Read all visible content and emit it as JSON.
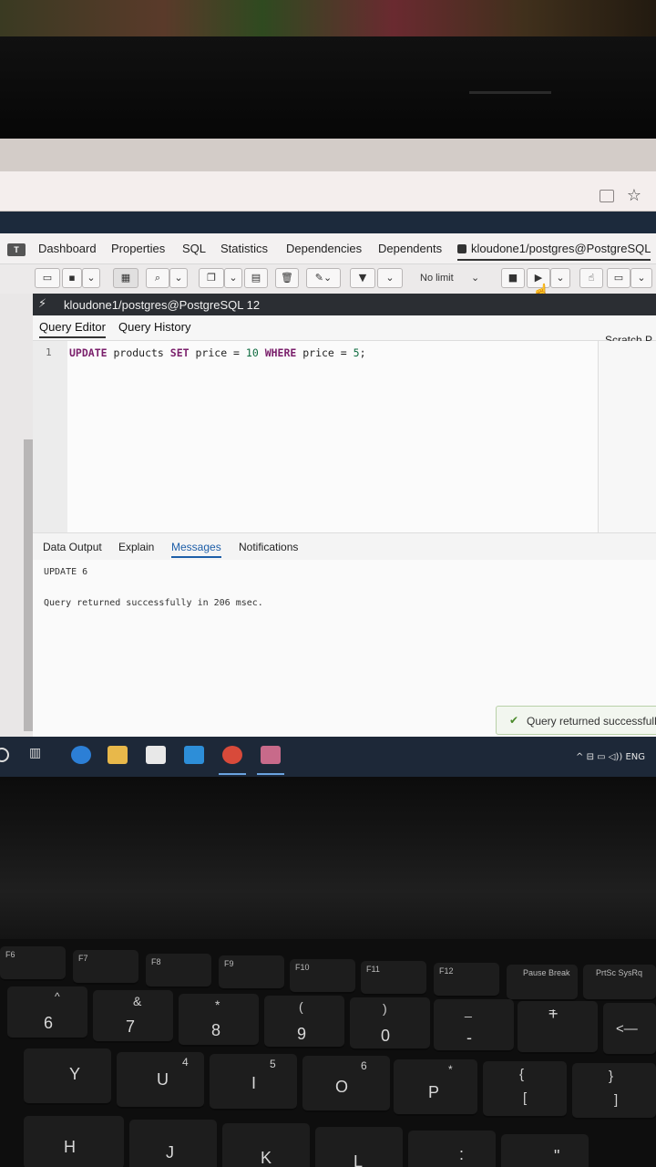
{
  "browser": {
    "reader_icon": "reader-icon",
    "star_icon": "star-icon"
  },
  "pgadmin": {
    "tabs": [
      {
        "label": "Dashboard"
      },
      {
        "label": "Properties"
      },
      {
        "label": "SQL"
      },
      {
        "label": "Statistics"
      },
      {
        "label": "Dependencies"
      },
      {
        "label": "Dependents"
      },
      {
        "label": "kloudone1/postgres@PostgreSQL"
      }
    ],
    "toolbar": {
      "limit_select": "No limit"
    },
    "connection": "kloudone1/postgres@PostgreSQL 12",
    "editor_tabs": [
      "Query Editor",
      "Query History"
    ],
    "scratch_label": "Scratch P",
    "editor": {
      "line_number": "1",
      "code": {
        "kw1": "UPDATE",
        "t1": " products ",
        "kw2": "SET",
        "t2": " price = ",
        "n1": "10",
        "t3": " ",
        "kw3": "WHERE",
        "t4": " price = ",
        "n2": "5",
        "t5": ";"
      }
    },
    "output_tabs": [
      "Data Output",
      "Explain",
      "Messages",
      "Notifications"
    ],
    "messages": {
      "line1": "UPDATE 6",
      "line2": "Query returned successfully in 206 msec."
    },
    "toast": "Query returned successfully"
  },
  "taskbar": {
    "tray_text": "^ ⊟ ▭ ◁)) ENG"
  },
  "keyboard": {
    "fn_row": [
      "F6",
      "F7",
      "F8",
      "F9",
      "F10",
      "F11",
      "F12",
      "Pause Break",
      "PrtSc SysRq"
    ],
    "num_row": [
      "6",
      "7",
      "8",
      "9",
      "0",
      "-",
      "+",
      "<—"
    ],
    "num_row_shift": [
      "^",
      "&",
      "*",
      "(",
      ")",
      "_",
      "=",
      ""
    ],
    "alpha_row": [
      "Y",
      "U",
      "I",
      "O",
      "P",
      "{",
      "}"
    ],
    "alpha_row_sub": [
      "",
      "4",
      "5",
      "6",
      "*",
      "[",
      "]"
    ],
    "home_row": [
      "H",
      "J",
      "K",
      "L",
      ":",
      "\""
    ]
  }
}
